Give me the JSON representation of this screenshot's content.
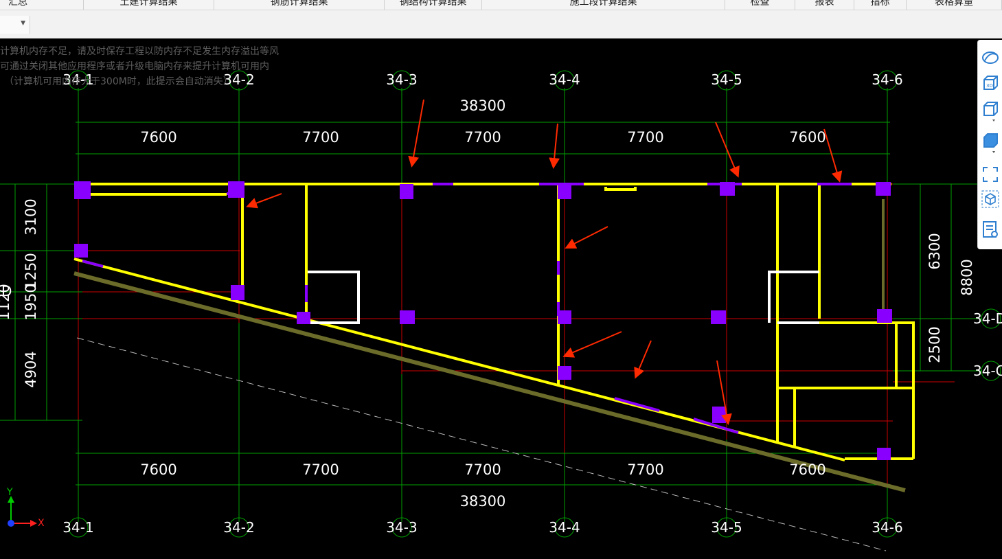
{
  "menu": [
    {
      "label": "汇总"
    },
    {
      "label": "土建计算结果"
    },
    {
      "label": "钢筋计算结果"
    },
    {
      "label": "钢结构计算结果"
    },
    {
      "label": "施工段计算结果"
    },
    {
      "label": "检查"
    },
    {
      "label": "报表"
    },
    {
      "label": "指标"
    },
    {
      "label": "表格算量"
    }
  ],
  "memory_warning": [
    "计算机内存不足，请及时保存工程以防内存不足发生内存溢出等风",
    "可通过关闭其他应用程序或者升级电脑内存来提升计算机可用内",
    "（计算机可用内存大于300M时，此提示会自动消失）"
  ],
  "axes": {
    "top": [
      "34-1",
      "34-2",
      "34-3",
      "34-4",
      "34-5",
      "34-6"
    ],
    "bottom": [
      "34-1",
      "34-2",
      "34-3",
      "34-4",
      "34-5",
      "34-6"
    ],
    "right": [
      "34-D",
      "34-C"
    ],
    "left_partial": "D"
  },
  "dimensions": {
    "total_top": "38300",
    "total_bottom": "38300",
    "spans_top": [
      "7600",
      "7700",
      "7700",
      "7700",
      "7600"
    ],
    "spans_bottom": [
      "7600",
      "7700",
      "7700",
      "7700",
      "7600"
    ],
    "left": [
      "3100",
      "1250",
      "1950",
      "4904",
      "1120"
    ],
    "right_inner": [
      "6300",
      "2500"
    ],
    "right_outer": "8800"
  },
  "coord_icon": {
    "y_label": "Y",
    "x_label": "X"
  },
  "right_toolbar": [
    "orbit-icon",
    "view-3d-icon",
    "box-view-icon",
    "solid-box-icon",
    "fullscreen-icon",
    "cube-select-icon",
    "properties-icon"
  ],
  "colors": {
    "wall": "#ffff00",
    "column": "#8a00ff",
    "grid": "#00b000",
    "axis_line": "#cc0000",
    "dim_text": "#ffffff",
    "arrow": "#ff2a00",
    "slab_edge": "#6b6b2a"
  }
}
